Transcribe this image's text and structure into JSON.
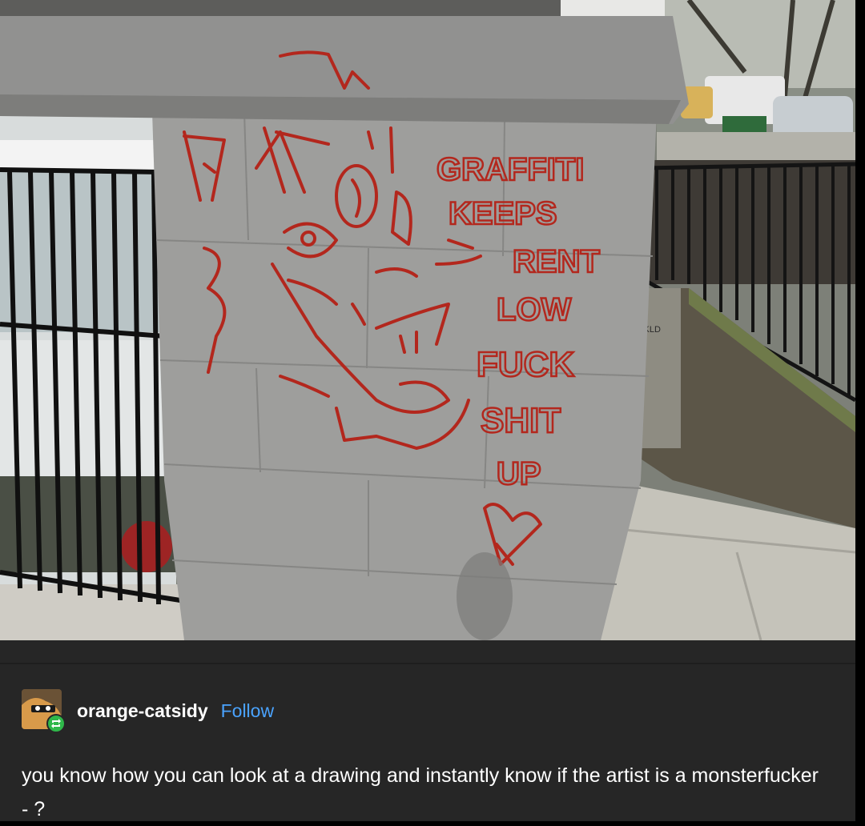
{
  "photo": {
    "graffiti_words": [
      "GRAFFITI",
      "KEEPS",
      "RENT",
      "LOW",
      "FUCK",
      "SHIT",
      "UP"
    ],
    "wall_text": "OKLD",
    "colors": {
      "graffiti": "#b3271d",
      "wall": "#9c9c9c",
      "ledge": "#8e8e8e"
    }
  },
  "post": {
    "avatar_icon": "avatar-cat",
    "reblog_icon": "reblog-icon",
    "username": "orange-catsidy",
    "follow_label": "Follow",
    "body": "you know how you can look at a drawing and instantly know if the artist is a monsterfucker - ?",
    "colors": {
      "background": "#262626",
      "follow": "#4aa3ff",
      "reblog": "#2fb84a"
    }
  }
}
